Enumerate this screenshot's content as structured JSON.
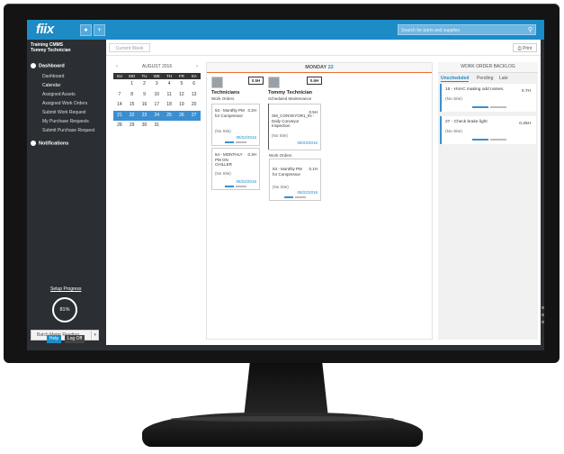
{
  "app": {
    "logo": "fiix",
    "search_placeholder": "Search for parts and supplies"
  },
  "sidebar": {
    "org": "Training CMMS",
    "user": "Tommy Technician",
    "dashboard_label": "Dashboard",
    "items": [
      {
        "label": "Dashboard"
      },
      {
        "label": "Calendar"
      },
      {
        "label": "Assigned Assets"
      },
      {
        "label": "Assigned Work Orders"
      },
      {
        "label": "Submit Work Request"
      },
      {
        "label": "My Purchase Requests"
      },
      {
        "label": "Submit Purchase Request"
      }
    ],
    "notifications_label": "Notifications",
    "setup_label": "Setup Progress",
    "setup_percent": "81%",
    "setup_fraction": 0.81,
    "batch_label": "Batch Meter Reading",
    "help_label": "Help",
    "logoff_label": "Log Off"
  },
  "toolbar": {
    "current_week": "Current Week",
    "print": "Print"
  },
  "calendar": {
    "month": "AUGUST 2016",
    "dow": [
      "SU",
      "MO",
      "TU",
      "WE",
      "TH",
      "FR",
      "SA"
    ],
    "weeks": [
      [
        "",
        "1",
        "2",
        "3",
        "4",
        "5",
        "6"
      ],
      [
        "7",
        "8",
        "9",
        "10",
        "11",
        "12",
        "13"
      ],
      [
        "14",
        "15",
        "16",
        "17",
        "18",
        "19",
        "20"
      ],
      [
        "21",
        "22",
        "23",
        "24",
        "25",
        "26",
        "27"
      ],
      [
        "28",
        "29",
        "30",
        "31",
        "",
        "",
        ""
      ]
    ],
    "selected_week_index": 3
  },
  "dayview": {
    "day": "MONDAY",
    "date": "22",
    "columns": [
      {
        "hours": "0.5H",
        "name": "Technicians",
        "role": "Work Orders",
        "cards": [
          {
            "title": "53 - Monthly PM for Compressor",
            "hours": "0.2H",
            "site": "(No Site)",
            "date": "08/22/2016"
          },
          {
            "title": "54 - MONTHLY PM ON CHILLER",
            "hours": "0.3H",
            "site": "(No Site)",
            "date": "08/22/2016"
          }
        ]
      },
      {
        "hours": "0.6H",
        "name": "Tommy Technician",
        "role": "Scheduled Maintenance",
        "sm_card": {
          "title": "SM_CONVEYOR1_IN - Daily Conveyor Inspection",
          "hours": "0.5H",
          "site": "(No Site)",
          "date": "08/23/2016"
        },
        "wo_label": "Work Orders",
        "cards": [
          {
            "title": "53 - Monthly PM for Compressor",
            "hours": "0.1H",
            "site": "(No Site)",
            "date": "08/22/2016"
          }
        ]
      }
    ]
  },
  "backlog": {
    "title": "WORK ORDER BACKLOG",
    "tabs": [
      "Unscheduled",
      "Pending",
      "Late"
    ],
    "active_tab": "Unscheduled",
    "items": [
      {
        "title": "15 - HVAC making odd noises.",
        "hours": "0.7H",
        "site": "(No Site)"
      },
      {
        "title": "27 - Check brake light",
        "hours": "0.25H",
        "site": "(No Site)"
      }
    ]
  },
  "colors": {
    "accent": "#1d8bc6",
    "sidebar_bg": "#2b2f33",
    "today_line": "#e76f2a"
  },
  "icons": [
    "user-icon",
    "add-icon",
    "search-icon",
    "print-icon",
    "dashboard-icon",
    "notifications-icon",
    "chevron-left-icon",
    "chevron-right-icon",
    "caret-down-icon",
    "avatar-icon"
  ]
}
